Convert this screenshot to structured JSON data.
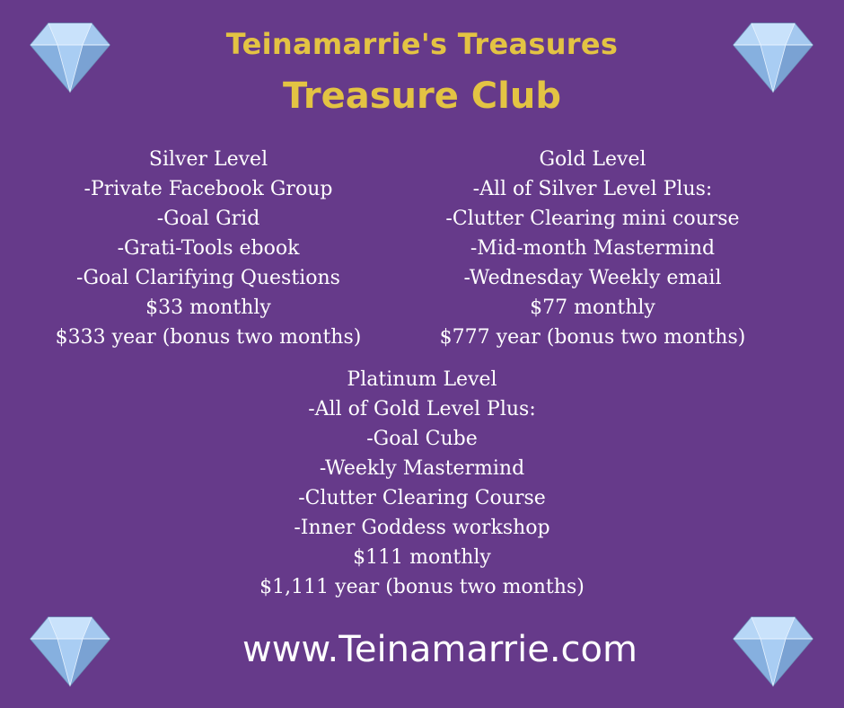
{
  "title": {
    "line1": "Teinamarrie's Treasures",
    "line2": "Treasure Club"
  },
  "levels": {
    "silver": {
      "heading": "Silver Level",
      "items": [
        "-Private Facebook Group",
        "-Goal Grid",
        "-Grati-Tools ebook",
        "-Goal Clarifying Questions"
      ],
      "monthly": "$33 monthly",
      "yearly": "$333 year (bonus two months)"
    },
    "gold": {
      "heading": "Gold Level",
      "items": [
        "-All of Silver Level Plus:",
        "-Clutter Clearing mini course",
        "-Mid-month Mastermind",
        "-Wednesday Weekly email"
      ],
      "monthly": "$77 monthly",
      "yearly": "$777 year (bonus two months)"
    },
    "platinum": {
      "heading": "Platinum Level",
      "items": [
        "-All of Gold Level Plus:",
        "-Goal Cube",
        "-Weekly Mastermind",
        "-Clutter Clearing Course",
        "-Inner Goddess workshop"
      ],
      "monthly": "$111 monthly",
      "yearly": "$1,111 year (bonus two months)"
    }
  },
  "website": "www.Teinamarrie.com",
  "colors": {
    "background": "#663a8a",
    "title": "#e3c343",
    "text": "#ffffff",
    "gem": "#9ec6f0"
  },
  "icons": [
    "diamond-icon"
  ]
}
